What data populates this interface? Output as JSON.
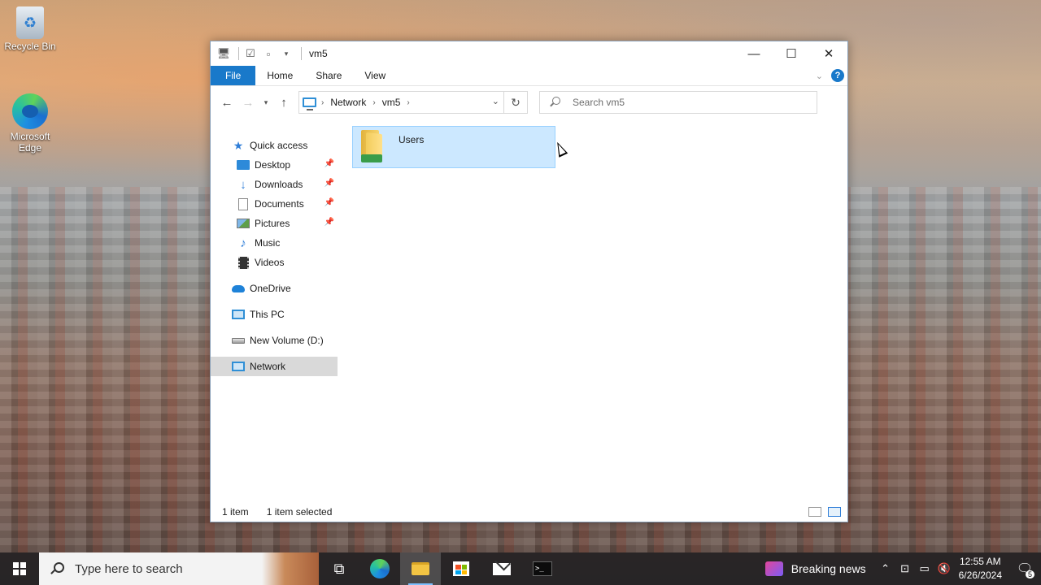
{
  "desktop": {
    "icons": [
      {
        "label": "Recycle Bin"
      },
      {
        "label": "Microsoft Edge"
      }
    ]
  },
  "window": {
    "title": "vm5",
    "ribbon_tabs": [
      "File",
      "Home",
      "Share",
      "View"
    ],
    "help_label": "?",
    "address": {
      "crumbs": [
        "Network",
        "vm5"
      ]
    },
    "search": {
      "placeholder": "Search vm5"
    },
    "nav": {
      "quick_access": "Quick access",
      "quick_items": [
        "Desktop",
        "Downloads",
        "Documents",
        "Pictures",
        "Music",
        "Videos"
      ],
      "onedrive": "OneDrive",
      "this_pc": "This PC",
      "new_volume": "New Volume (D:)",
      "network": "Network"
    },
    "items": [
      {
        "name": "Users",
        "selected": true
      }
    ],
    "status": {
      "count": "1 item",
      "selection": "1 item selected"
    }
  },
  "taskbar": {
    "search_placeholder": "Type here to search",
    "news": "Breaking news",
    "time": "12:55 AM",
    "date": "6/26/2024",
    "notifications": "5",
    "terminal_glyph": ">_"
  },
  "colors": {
    "accent": "#1979ca",
    "selection_bg": "#cce8ff",
    "selection_border": "#99d1ff"
  }
}
